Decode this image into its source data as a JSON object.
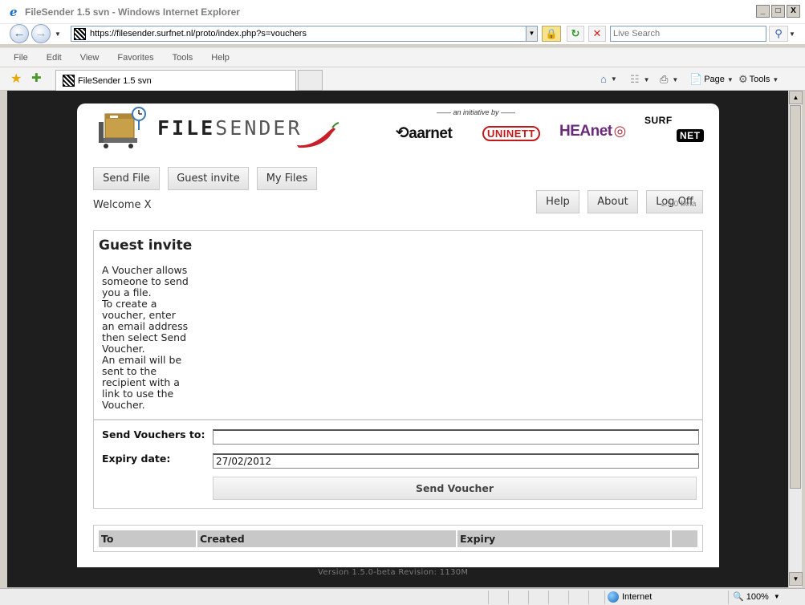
{
  "window": {
    "title": "FileSender 1.5 svn - Windows Internet Explorer",
    "controls": [
      "_",
      "□",
      "X"
    ]
  },
  "address_bar": {
    "url": "https://filesender.surfnet.nl/proto/index.php?s=vouchers",
    "search_placeholder": "Live Search"
  },
  "menu": [
    "File",
    "Edit",
    "View",
    "Favorites",
    "Tools",
    "Help"
  ],
  "tab": {
    "label": "FileSender 1.5 svn"
  },
  "command_bar": {
    "page_label": "Page",
    "tools_label": "Tools"
  },
  "header": {
    "brand_main": "FILE",
    "brand_rest": "SENDER",
    "initiative": "—— an initiative by ——",
    "partners": {
      "aarnet": "aarnet",
      "uninett": "UNINETT",
      "heanet": "HEAnet",
      "surf": "SURF",
      "net": "NET"
    }
  },
  "nav": {
    "send_file": "Send File",
    "guest_invite": "Guest invite",
    "my_files": "My Files",
    "help": "Help",
    "about": "About",
    "log_off": "Log Off",
    "beta": "1.5.0 beta"
  },
  "welcome": "Welcome X",
  "guest_invite": {
    "title": "Guest invite",
    "description": "A Voucher allows someone to send you a file. To create a voucher, enter an email address then select Send Voucher. An email will be sent to the recipient with a link to use the Voucher.",
    "desc_lines": [
      "A Voucher allows",
      "someone to send",
      "you a file.",
      "To create a",
      "voucher, enter",
      "an email address",
      "then select Send",
      "Voucher.",
      "An email will be",
      "sent to the",
      "recipient with a",
      "link to use the",
      "Voucher."
    ],
    "send_to_label": "Send Vouchers to:",
    "send_to_value": "",
    "expiry_label": "Expiry date:",
    "expiry_value": "27/02/2012",
    "send_button": "Send Voucher"
  },
  "voucher_table": {
    "columns": [
      "To",
      "Created",
      "Expiry",
      ""
    ]
  },
  "footer": {
    "version": "Version 1.5.0-beta Revision: 1130M"
  },
  "status_bar": {
    "zone": "Internet",
    "zoom": "100%"
  }
}
